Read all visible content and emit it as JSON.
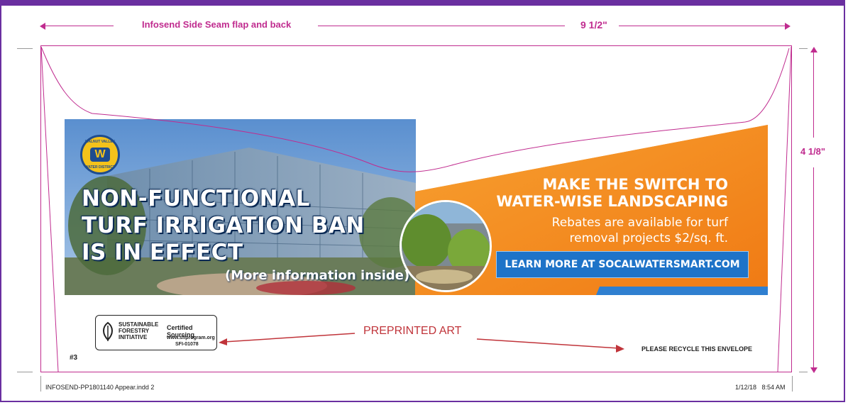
{
  "dimensions": {
    "top_label": "Infosend Side Seam flap and back",
    "width_label": "9 1/2\"",
    "height_label": "4 1/8\""
  },
  "banner": {
    "logo_text": {
      "top": "WALNUT VALLEY",
      "middle": "SERVING SINCE 1952",
      "bottom": "WATER DISTRICT",
      "letter": "W"
    },
    "headline": [
      "NON-FUNCTIONAL",
      "TURF IRRIGATION BAN",
      "IS IN EFFECT"
    ],
    "more_info": "(More information inside)",
    "right_headline": [
      "MAKE THE SWITCH TO",
      "WATER-WISE LANDSCAPING"
    ],
    "right_sub": [
      "Rebates are available for turf",
      "removal projects $2/sq. ft."
    ],
    "button_label": "LEARN MORE AT SOCALWATERSMART.COM"
  },
  "sfi": {
    "name": [
      "SUSTAINABLE",
      "FORESTRY",
      "INITIATIVE"
    ],
    "certified": "Certified Sourcing",
    "url": "www.sfiprogram.org",
    "code": "SFI-01078"
  },
  "annotations": {
    "preprinted": "PREPRINTED ART",
    "recycle": "PLEASE RECYCLE THIS ENVELOPE",
    "number": "#3"
  },
  "footer": {
    "filename": "INFOSEND-PP1801140 Appear.indd  2",
    "timestamp": "1/12/18   8:54 AM"
  },
  "colors": {
    "dimension": "#c02c8f",
    "frame": "#6a2fa0",
    "orange": "#f58a1f",
    "button_blue": "#1e73c8",
    "arrow_red": "#c0343a"
  }
}
